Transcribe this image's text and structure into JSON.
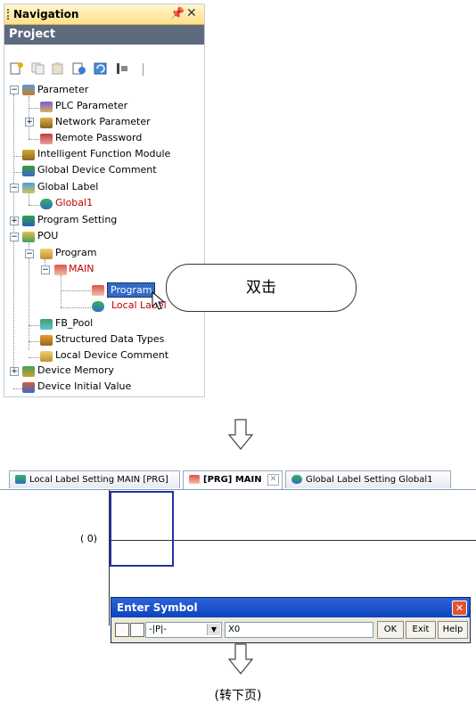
{
  "navigation": {
    "title": "Navigation",
    "pin_glyph": "4",
    "close_glyph": "✕",
    "project_label": "Project",
    "tree": {
      "parameter": "Parameter",
      "plc_parameter": "PLC Parameter",
      "network_parameter": "Network Parameter",
      "remote_password": "Remote Password",
      "intelligent_function_module": "Intelligent Function Module",
      "global_device_comment": "Global Device Comment",
      "global_label": "Global Label",
      "global1": "Global1",
      "program_setting": "Program Setting",
      "pou": "POU",
      "program_folder": "Program",
      "main": "MAIN",
      "program": "Program",
      "local_label": "Local Label",
      "fb_pool": "FB_Pool",
      "structured_data_types": "Structured Data Types",
      "local_device_comment": "Local Device Comment",
      "device_memory": "Device Memory",
      "device_initial_value": "Device Initial Value"
    }
  },
  "callout": {
    "text": "双击"
  },
  "editor": {
    "tabs": [
      {
        "label": "Local Label Setting MAIN [PRG]"
      },
      {
        "label": "[PRG] MAIN"
      },
      {
        "label": "Global Label Setting Global1"
      }
    ],
    "rung_label": "(  0)",
    "dialog": {
      "title": "Enter Symbol",
      "instruction_select": "-|P|-",
      "input_value": "X0",
      "ok": "OK",
      "exit": "Exit",
      "help": "Help"
    }
  },
  "footer": {
    "text": "(转下页)"
  },
  "colors": {
    "highlight": "#316ac5",
    "red_text": "#c00000",
    "project_bar": "#5e6a7e",
    "dialog_title": "#0a44c0"
  }
}
